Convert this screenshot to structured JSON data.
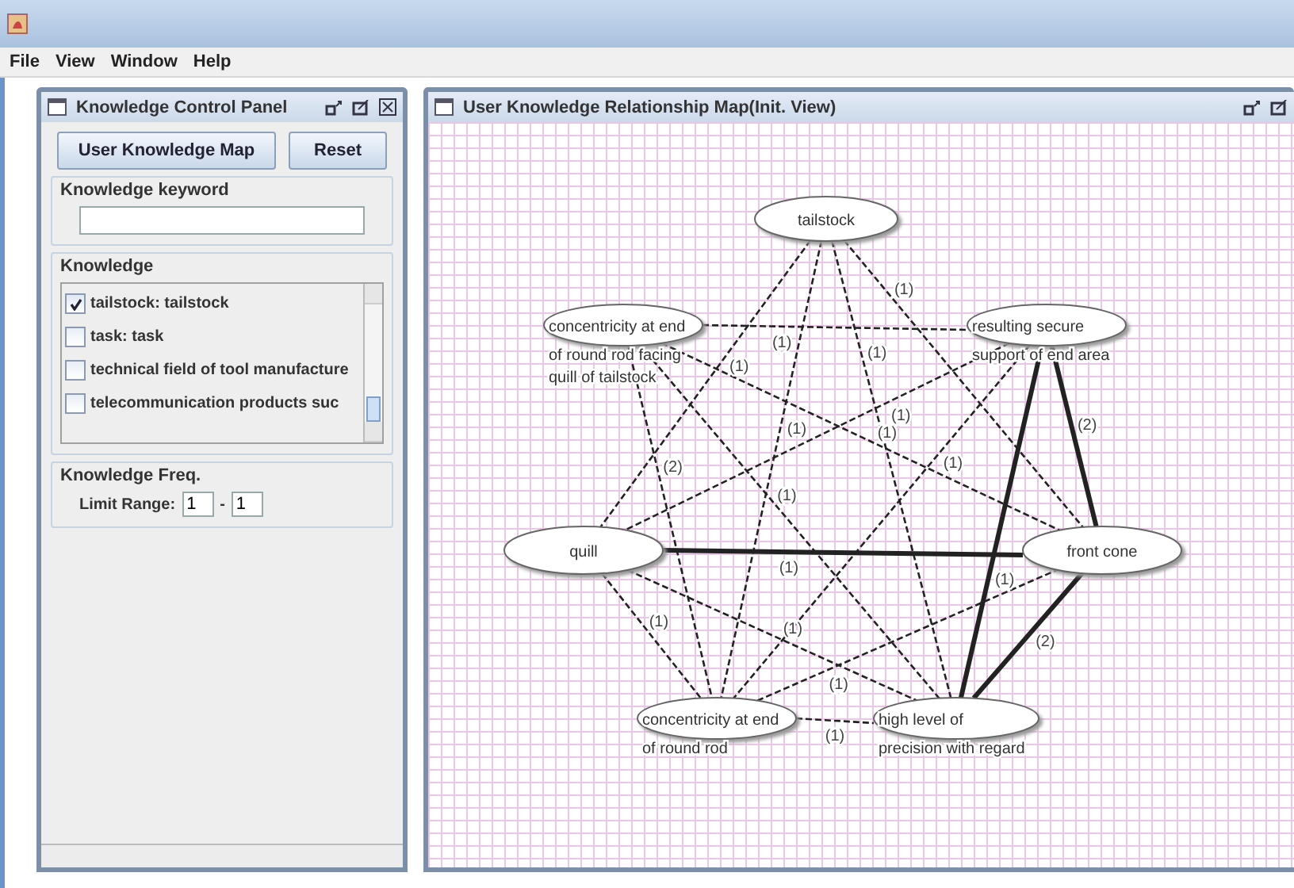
{
  "menu": [
    "File",
    "View",
    "Window",
    "Help"
  ],
  "control_panel": {
    "title": "Knowledge Control Panel",
    "buttons": [
      "User Knowledge Map",
      "Reset"
    ],
    "keyword": {
      "legend": "Knowledge keyword"
    },
    "knowledge": {
      "legend": "Knowledge",
      "items": [
        {
          "label": "tailstock: tailstock",
          "checked": true
        },
        {
          "label": "task: task",
          "checked": false
        },
        {
          "label": "technical field of tool manufacture",
          "checked": false
        },
        {
          "label": "telecommunication products suc",
          "checked": false
        }
      ]
    },
    "freq": {
      "legend": "Knowledge Freq.",
      "label": "Limit Range:",
      "from": "1",
      "separator": "-",
      "to": "1"
    }
  },
  "map": {
    "title": "User Knowledge Relationship Map(Init. View)",
    "nodes": [
      {
        "label_lines": [
          "tailstock"
        ],
        "centered": true
      },
      {
        "label_lines": [
          "concentricity at end",
          "of round rod facing",
          "quill of tailstock"
        ],
        "centered": false
      },
      {
        "label_lines": [
          "resulting secure",
          "support of end area"
        ],
        "centered": false
      },
      {
        "label_lines": [
          "quill"
        ],
        "centered": true
      },
      {
        "label_lines": [
          "front cone"
        ],
        "centered": true
      },
      {
        "label_lines": [
          "concentricity at end",
          "of round rod"
        ],
        "centered": false
      },
      {
        "label_lines": [
          "high level of",
          "precision with regard"
        ],
        "centered": false
      }
    ],
    "edges": [
      {
        "label": "(1)",
        "strong": false
      },
      {
        "label": "(1)",
        "strong": false
      },
      {
        "label": "(1)",
        "strong": false
      },
      {
        "label": "(1)",
        "strong": false
      },
      {
        "label": "(1)",
        "strong": false
      },
      {
        "label": "(1)",
        "strong": false
      },
      {
        "label": "(1)",
        "strong": false
      },
      {
        "label": "(1)",
        "strong": false
      },
      {
        "label": "(1)",
        "strong": false
      },
      {
        "label": "(1)",
        "strong": true
      },
      {
        "label": "(1)",
        "strong": false
      },
      {
        "label": "(1)",
        "strong": false
      },
      {
        "label": "(1)",
        "strong": false
      },
      {
        "label": "(1)",
        "strong": true
      },
      {
        "label": "(1)",
        "strong": false
      },
      {
        "label": "(2)",
        "strong": true
      },
      {
        "label": "(2)",
        "strong": true
      },
      {
        "label": "(2)",
        "strong": false
      }
    ]
  }
}
